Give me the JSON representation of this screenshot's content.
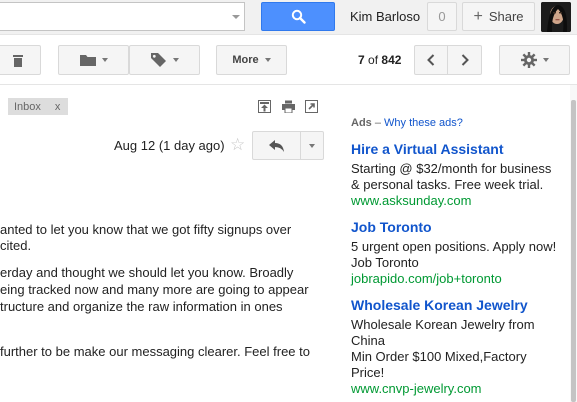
{
  "header": {
    "search_placeholder": "",
    "user_name": "Kim Barloso",
    "notification_count": "0",
    "share_label": "Share",
    "share_plus": "+"
  },
  "toolbar": {
    "more_label": "More",
    "pager_current": "7",
    "pager_of": "of",
    "pager_total": "842"
  },
  "email": {
    "label": "Inbox",
    "label_remove": "x",
    "date": "Aug 12 (1 day ago)",
    "star": "☆",
    "body_lines": [
      "anted to let you know that we got fifty signups over",
      "cited.",
      "erday and thought we should let you know. Broadly",
      "eing tracked now and many more are going to appear",
      "tructure and organize the raw information in ones",
      "further to be make our messaging clearer. Feel free to"
    ]
  },
  "ads": {
    "header_word": "Ads",
    "header_dash": "–",
    "why_label": "Why these ads?",
    "items": [
      {
        "title": "Hire a Virtual Assistant",
        "lines": [
          "Starting @ $32/month for business",
          "& personal tasks. Free week trial."
        ],
        "url": "www.asksunday.com"
      },
      {
        "title": "Job Toronto",
        "lines": [
          "5 urgent open positions. Apply now!",
          "Job Toronto"
        ],
        "url": "jobrapido.com/job+toronto"
      },
      {
        "title": "Wholesale Korean Jewelry",
        "lines": [
          "Wholesale Korean Jewelry from",
          "China",
          "Min Order $100 Mixed,Factory",
          "Price!"
        ],
        "url": "www.cnvp-jewelry.com"
      }
    ]
  },
  "colors": {
    "search_blue": "#4d90fe",
    "link_blue": "#1155cc",
    "url_green": "#009933"
  }
}
